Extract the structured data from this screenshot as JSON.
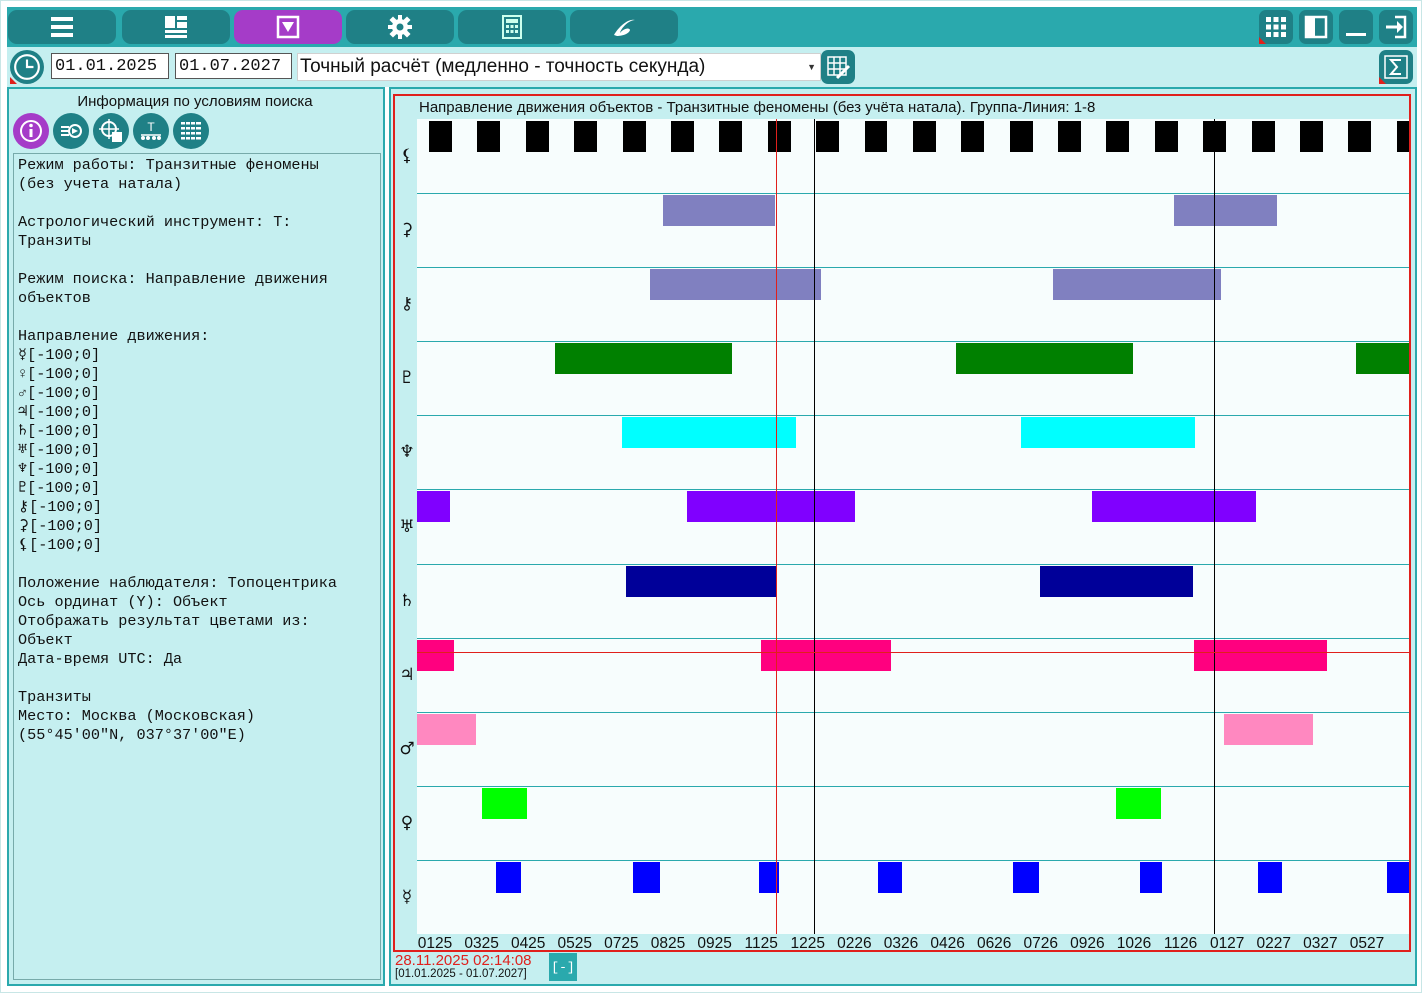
{
  "toolbar": {
    "tabs": [
      {
        "icon": "menu-list-icon",
        "active": false
      },
      {
        "icon": "layout-icon",
        "active": false
      },
      {
        "icon": "filter-icon",
        "active": true
      },
      {
        "icon": "gear-icon",
        "active": false
      },
      {
        "icon": "calculator-icon",
        "active": false
      },
      {
        "icon": "swirl-logo-icon",
        "active": false
      }
    ],
    "right_buttons": [
      "grid-icon",
      "panel-toggle-icon",
      "minimize-icon",
      "exit-icon"
    ],
    "accent": "#2aa9ad",
    "button_color": "#1f8086",
    "active_color": "#a53cc8"
  },
  "controls": {
    "date_from": "01.01.2025",
    "date_to": "01.07.2027",
    "mode": "Точный расчёт (медленно - точность секунда)"
  },
  "left_panel": {
    "title": "Информация по условиям поиска",
    "icons": [
      "info-icon",
      "export-icon",
      "target-grid-icon",
      "transit-icon",
      "list-grid-icon"
    ],
    "info_lines": [
      "Режим работы: Транзитные феномены",
      "(без учета натала)",
      "",
      "Астрологический инструмент: Т:",
      "Транзиты",
      "",
      "Режим поиска: Направление движения",
      "объектов",
      "",
      "Направление движения:",
      "☿[-100;0]",
      "♀[-100;0]",
      "♂[-100;0]",
      "♃[-100;0]",
      "♄[-100;0]",
      "♅[-100;0]",
      "♆[-100;0]",
      "♇[-100;0]",
      "⚷[-100;0]",
      "⚳[-100;0]",
      "⚸[-100;0]",
      "",
      "Положение наблюдателя: Топоцентрика",
      "Ось ординат (Y): Объект",
      "Отображать результат цветами из:",
      "Объект",
      "Дата-время UTC: Да",
      "",
      "Транзиты",
      "Место: Москва (Московская)",
      "(55°45'00\"N, 037°37'00\"E)"
    ]
  },
  "chart": {
    "title": "Направление движения объектов - Транзитные феномены (без учёта натала). Группа-Линия: 1-8",
    "cursor_datetime": "28.11.2025 02:14:08",
    "range_label": "[01.01.2025 - 01.07.2027]",
    "collapse_label": "[-]"
  },
  "chart_data": {
    "type": "timeline",
    "x_ticks": [
      "0125",
      "0325",
      "0425",
      "0525",
      "0725",
      "0825",
      "0925",
      "1125",
      "1225",
      "0226",
      "0326",
      "0426",
      "0626",
      "0726",
      "0926",
      "1026",
      "1126",
      "0127",
      "0227",
      "0327",
      "0527"
    ],
    "rows": [
      {
        "symbol": "⚸",
        "color": "#000000",
        "kind": "dense-segments"
      },
      {
        "symbol": "⚳",
        "color": "#8080c0",
        "bars": [
          [
            24.8,
            36.1
          ],
          [
            76.3,
            86.7
          ]
        ]
      },
      {
        "symbol": "⚷",
        "color": "#8080c0",
        "bars": [
          [
            23.5,
            40.7
          ],
          [
            64.1,
            81.1
          ]
        ]
      },
      {
        "symbol": "♇",
        "color": "#008000",
        "bars": [
          [
            13.9,
            31.8
          ],
          [
            54.3,
            72.2
          ],
          [
            94.7,
            100
          ]
        ]
      },
      {
        "symbol": "♆",
        "color": "#00ffff",
        "bars": [
          [
            20.7,
            38.2
          ],
          [
            60.9,
            78.4
          ]
        ]
      },
      {
        "symbol": "♅",
        "color": "#8000ff",
        "bars": [
          [
            0,
            3.3
          ],
          [
            27.2,
            44.2
          ],
          [
            68.0,
            84.6
          ]
        ]
      },
      {
        "symbol": "♄",
        "color": "#000099",
        "bars": [
          [
            21.1,
            36.3
          ],
          [
            62.8,
            78.2
          ]
        ]
      },
      {
        "symbol": "♃",
        "color": "#ff007f",
        "bars": [
          [
            0,
            3.7
          ],
          [
            34.7,
            47.8
          ],
          [
            78.3,
            91.7
          ]
        ]
      },
      {
        "symbol": "♂",
        "color": "#ff88c0",
        "bars": [
          [
            0,
            5.9
          ],
          [
            81.4,
            90.3
          ]
        ]
      },
      {
        "symbol": "♀",
        "color": "#00ff00",
        "bars": [
          [
            6.6,
            11.1
          ],
          [
            70.5,
            75.0
          ]
        ]
      },
      {
        "symbol": "☿",
        "color": "#0000ff",
        "bars": [
          [
            8.0,
            10.5
          ],
          [
            21.8,
            24.5
          ],
          [
            34.5,
            36.5
          ],
          [
            46.5,
            48.9
          ],
          [
            60.1,
            62.7
          ],
          [
            72.9,
            75.1
          ],
          [
            84.8,
            87.2
          ],
          [
            97.8,
            100
          ]
        ]
      }
    ],
    "cursor_color": "#e0201c",
    "marker_color": "#000000"
  }
}
